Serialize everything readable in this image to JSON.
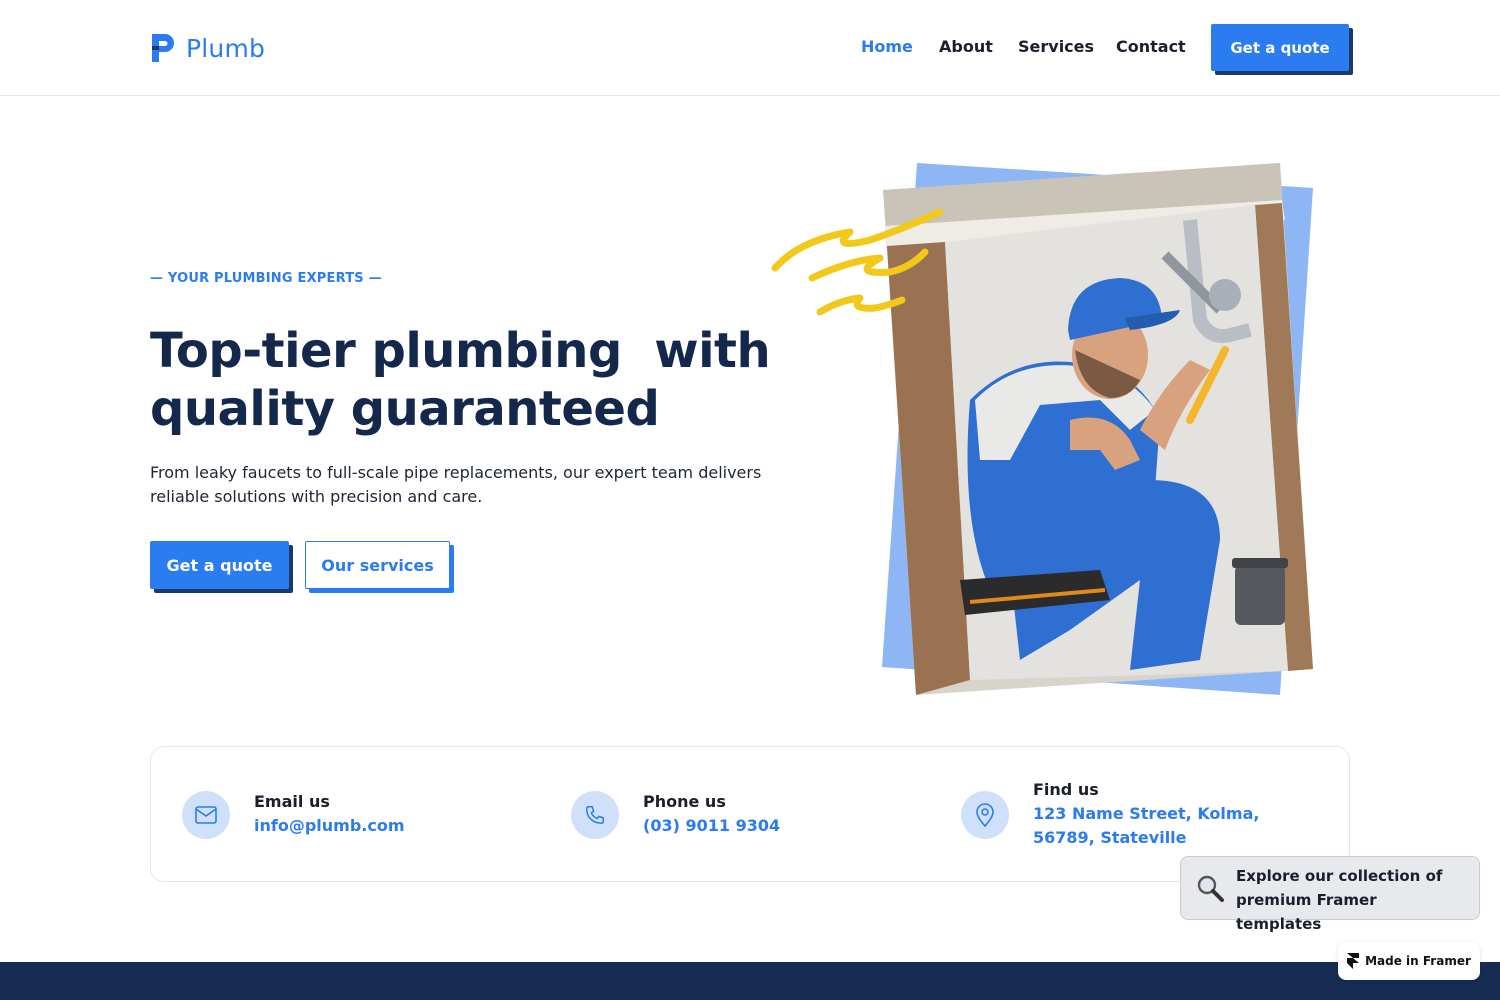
{
  "brand": {
    "name": "Plumb",
    "accent": "#2b7cf0",
    "navy": "#13284b"
  },
  "nav": {
    "items": [
      {
        "label": "Home",
        "active": true
      },
      {
        "label": "About",
        "active": false
      },
      {
        "label": "Services",
        "active": false
      },
      {
        "label": "Contact",
        "active": false
      }
    ],
    "cta": "Get a quote"
  },
  "hero": {
    "eyebrow": "— YOUR PLUMBING EXPERTS —",
    "title_line1": "Top-tier plumbing  with",
    "title_line2": "quality guaranteed",
    "text": "From leaky faucets to full-scale pipe replacements, our expert team delivers reliable solutions with precision and care.",
    "primary_button": "Get a quote",
    "secondary_button": "Our services"
  },
  "contact": {
    "email": {
      "label": "Email us",
      "value": "info@plumb.com",
      "icon": "mail-icon"
    },
    "phone": {
      "label": "Phone us",
      "value": "(03) 9011 9304",
      "icon": "phone-icon"
    },
    "location": {
      "label": "Find us",
      "value": "123 Name Street, Kolma, 56789, Stateville",
      "icon": "map-pin-icon"
    }
  },
  "framer": {
    "promo": "Explore our collection of premium Framer templates",
    "badge": "Made in Framer"
  }
}
